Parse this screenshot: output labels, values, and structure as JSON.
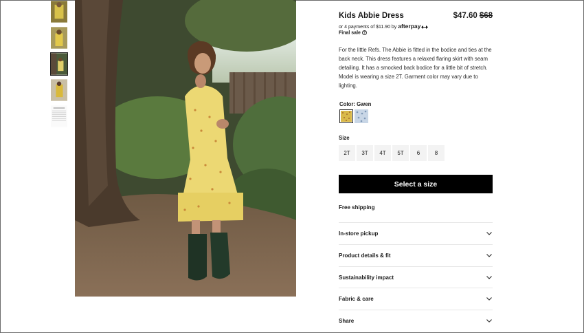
{
  "product": {
    "title": "Kids Abbie Dress",
    "price": "$47.60",
    "original_price": "$68",
    "installments_text": "or 4 payments of $11.90 by",
    "afterpay_brand": "afterpay",
    "final_sale": "Final sale",
    "description": "For the little Refs. The Abbie is fitted in the bodice and ties at the back neck. This dress features a relaxed flaring skirt with seam detailing. It has a smocked back bodice for a little bit of stretch. Model is wearing a size 2T. Garment color may vary due to lighting."
  },
  "color": {
    "label": "Color: Gwen",
    "swatches": [
      {
        "name": "Gwen",
        "selected": true,
        "color": "#d9b94a"
      },
      {
        "name": "Blue floral",
        "selected": false,
        "color": "#c8d6e6"
      }
    ]
  },
  "size": {
    "label": "Size",
    "options": [
      "2T",
      "3T",
      "4T",
      "5T",
      "6",
      "8"
    ]
  },
  "cta_label": "Select a size",
  "free_shipping": "Free shipping",
  "accordions": [
    "In-store pickup",
    "Product details & fit",
    "Sustainability impact",
    "Fabric & care",
    "Share"
  ],
  "thumbnails": {
    "count": 5,
    "active_index": 2
  },
  "icons": {
    "chevron": "chevron-down-icon",
    "info": "info-icon"
  }
}
